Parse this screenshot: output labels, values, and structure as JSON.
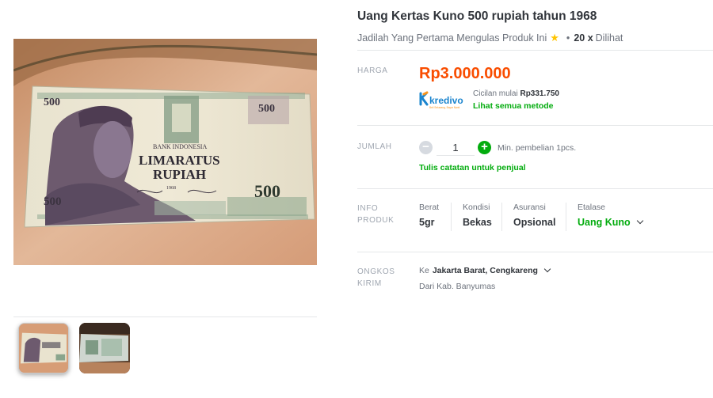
{
  "product": {
    "title": "Uang Kertas Kuno 500 rupiah tahun 1968",
    "review_prompt": "Jadilah Yang Pertama Mengulas Produk Ini",
    "view_count": "20 x",
    "view_label": "Dilihat"
  },
  "banknote": {
    "denomination": "500",
    "bank": "BANK INDONESIA",
    "amount_line1": "LIMARATUS",
    "amount_line2": "RUPIAH",
    "year": "1968"
  },
  "price": {
    "label": "HARGA",
    "value": "Rp3.000.000",
    "installment_prefix": "Cicilan mulai",
    "installment_value": "Rp331.750",
    "all_methods_link": "Lihat semua metode",
    "provider": "kredivo",
    "provider_tagline": "Beli Sekarang, Bayar Nanti"
  },
  "quantity": {
    "label": "JUMLAH",
    "value": "1",
    "minus": "−",
    "plus": "+",
    "min_purchase": "Min. pembelian 1pcs.",
    "notes_link": "Tulis catatan untuk penjual"
  },
  "info": {
    "label_line1": "INFO",
    "label_line2": "PRODUK",
    "berat_label": "Berat",
    "berat_value": "5gr",
    "kondisi_label": "Kondisi",
    "kondisi_value": "Bekas",
    "asuransi_label": "Asuransi",
    "asuransi_value": "Opsional",
    "etalase_label": "Etalase",
    "etalase_value": "Uang Kuno"
  },
  "shipping": {
    "label_line1": "ONGKOS",
    "label_line2": "KIRIM",
    "to_prefix": "Ke",
    "to_value": "Jakarta Barat, Cengkareng",
    "from": "Dari Kab. Banyumas"
  },
  "colors": {
    "price": "#f94d00",
    "accent_green": "#03ac0e",
    "star": "#ffc400",
    "kredivo_blue": "#1a84ce",
    "kredivo_orange": "#f7941d"
  },
  "icons": [
    "star-icon",
    "minus-icon",
    "plus-icon",
    "chevron-down-icon",
    "kredivo-logo"
  ]
}
